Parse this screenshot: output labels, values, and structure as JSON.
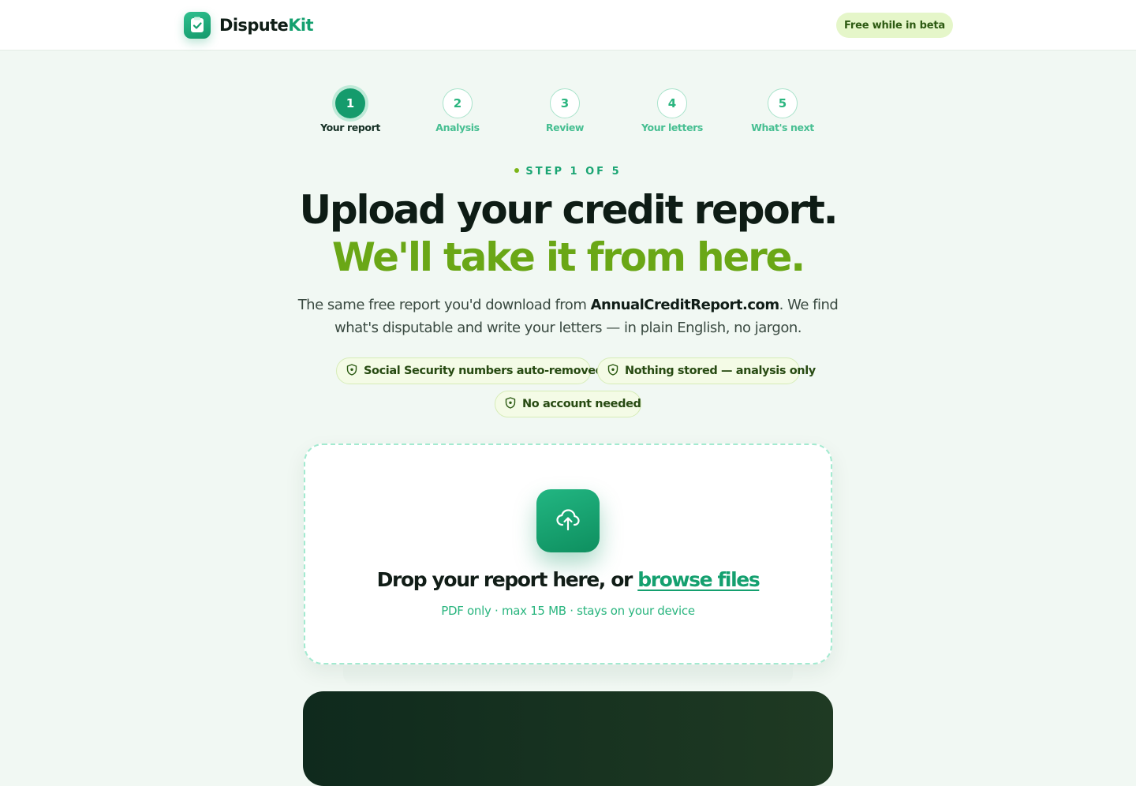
{
  "header": {
    "brand_primary": "Dispute",
    "brand_accent": "Kit",
    "beta_label": "Free while in beta"
  },
  "stepper": {
    "current": 1,
    "steps": [
      {
        "number": "1",
        "label": "Your report"
      },
      {
        "number": "2",
        "label": "Analysis"
      },
      {
        "number": "3",
        "label": "Review"
      },
      {
        "number": "4",
        "label": "Your letters"
      },
      {
        "number": "5",
        "label": "What's next"
      }
    ]
  },
  "hero": {
    "eyebrow": "STEP 1 OF 5",
    "headline_line1": "Upload your credit report.",
    "headline_line2": "We'll take it from here.",
    "subtext_before": "The same free report you'd download from ",
    "subtext_bold": "AnnualCreditReport.com",
    "subtext_after": ". We find what's disputable and write your letters — in plain English, no jargon."
  },
  "trust_pills": [
    {
      "label": "Social Security numbers auto-removed",
      "icon": "shield-icon"
    },
    {
      "label": "Nothing stored — analysis only",
      "icon": "shield-icon"
    },
    {
      "label": "No account needed",
      "icon": "shield-icon"
    }
  ],
  "upload": {
    "icon": "cloud-upload-icon",
    "title_text": "Drop your report here, or ",
    "browse_label": "browse files",
    "hint": "PDF only · max 15 MB · stays on your device"
  },
  "colors": {
    "accent_green": "#14a06f",
    "headline_lime": "#6aa716",
    "background": "#f1f8f3",
    "beta_pill": "#e5f6c9"
  }
}
